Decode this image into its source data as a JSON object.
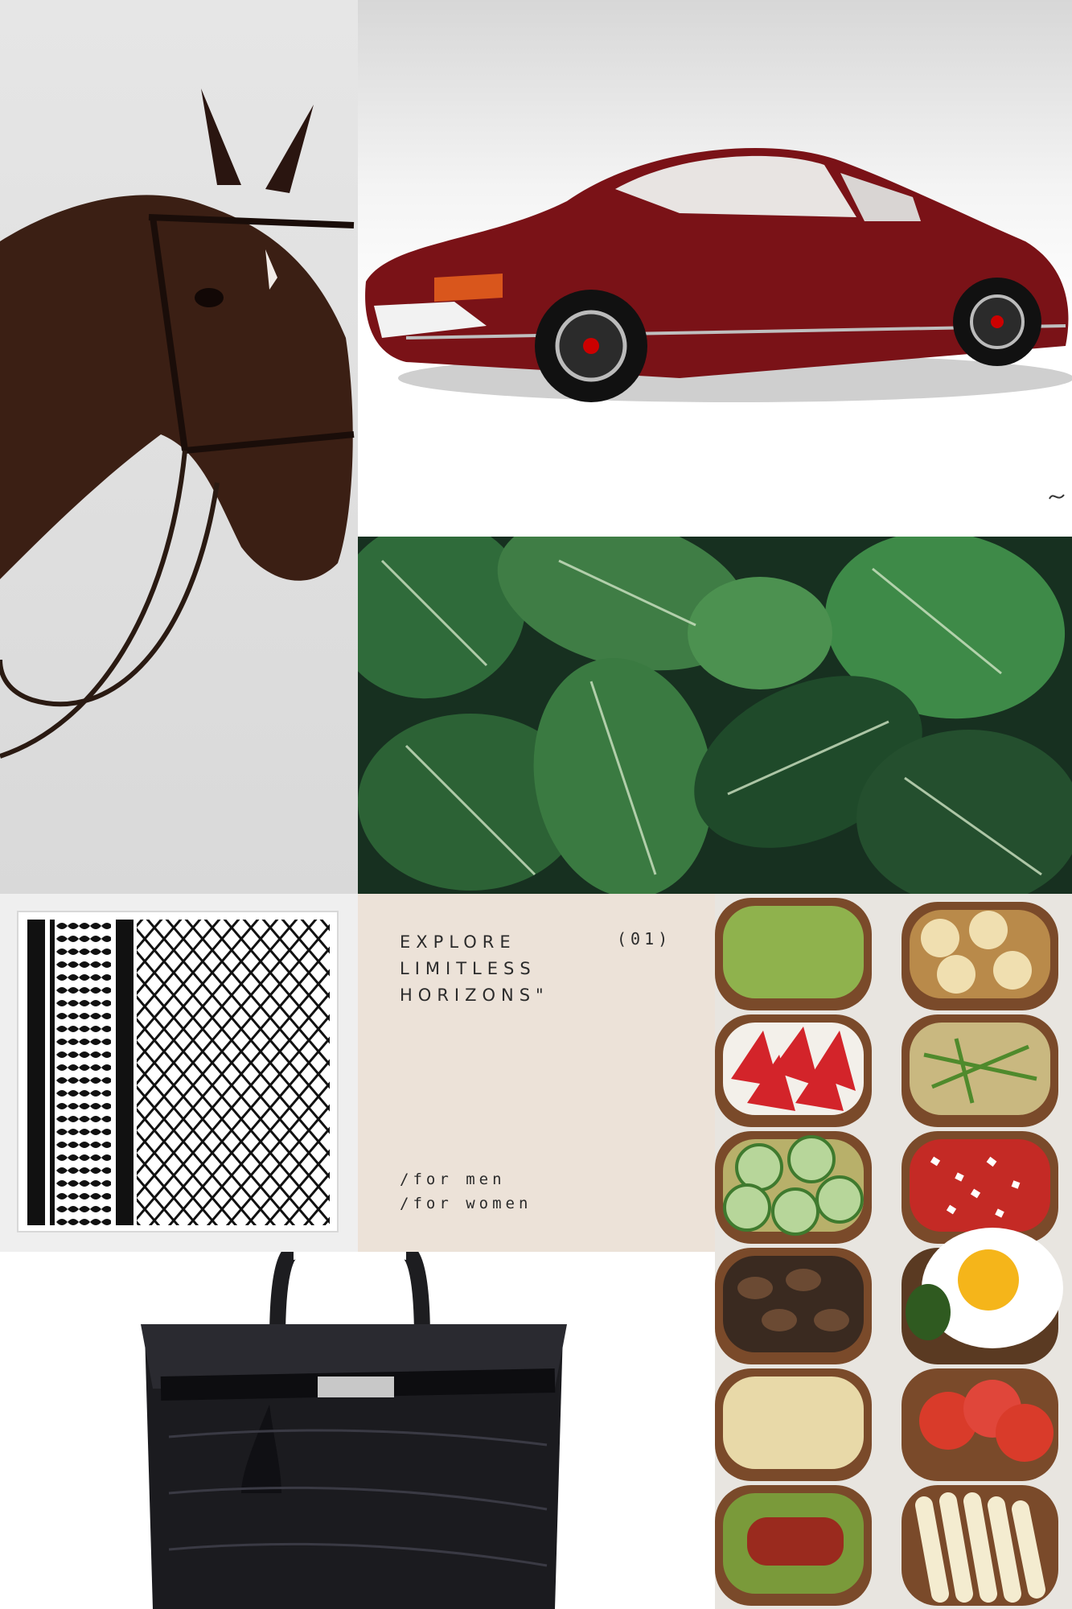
{
  "panel": {
    "headline": "EXPLORE\nLIMITLESS\nHORIZONS\"",
    "index": "(01)",
    "links": [
      "/for men",
      "/for women"
    ]
  },
  "tiles": [
    "horse",
    "car",
    "leaves",
    "pattern",
    "text-panel",
    "toasts",
    "bag"
  ],
  "colors": {
    "panel_background": "#ece2d8",
    "text": "#2b2b2b",
    "car_red": "#7a1217",
    "leaf_green": "#2f6b3a"
  }
}
